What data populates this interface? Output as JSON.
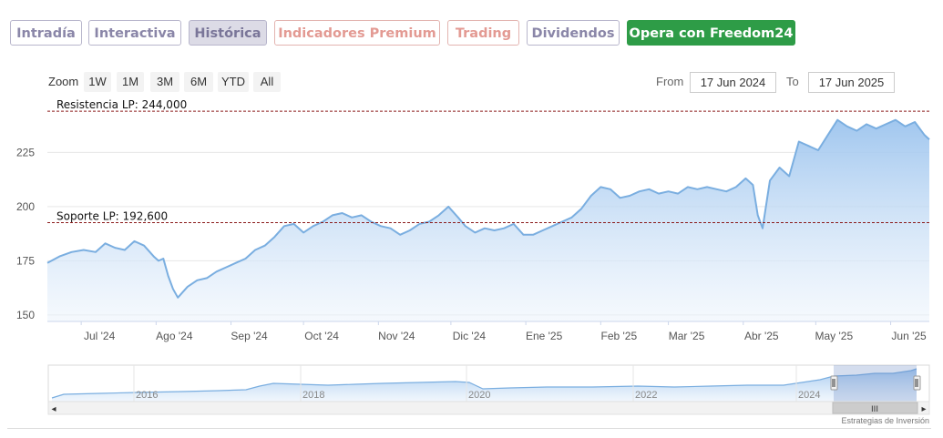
{
  "tabs": [
    {
      "label": "Intradía",
      "style": "default"
    },
    {
      "label": "Interactiva",
      "style": "default"
    },
    {
      "label": "Histórica",
      "style": "active"
    },
    {
      "label": "Indicadores Premium",
      "style": "warm"
    },
    {
      "label": "Trading",
      "style": "warm"
    },
    {
      "label": "Dividendos",
      "style": "default"
    },
    {
      "label": "Opera con Freedom24",
      "style": "cta"
    }
  ],
  "zoom": {
    "label": "Zoom",
    "buttons": [
      "1W",
      "1M",
      "3M",
      "6M",
      "YTD",
      "All"
    ]
  },
  "range": {
    "from_label": "From",
    "from_value": "17 Jun 2024",
    "to_label": "To",
    "to_value": "17 Jun 2025"
  },
  "colors": {
    "series": "#7aaee0",
    "fill_top": "#9cc4ee",
    "fill_bottom": "#edf4fc",
    "dashed_line": "#8b1a1a",
    "grid": "#e6e6e6",
    "cta": "#2e9c47"
  },
  "credit": "Estrategias de Inversión",
  "chart_data": {
    "type": "area",
    "title": "",
    "ylim": [
      147,
      247
    ],
    "y_ticks": [
      150,
      175,
      200,
      225
    ],
    "x_ticks": [
      "Jul '24",
      "Ago '24",
      "Sep '24",
      "Oct '24",
      "Nov '24",
      "Dic '24",
      "Ene '25",
      "Feb '25",
      "Mar '25",
      "Abr '25",
      "May '25",
      "Jun '25"
    ],
    "x_start": "2024-06-17",
    "x_end": "2025-06-17",
    "grid": true,
    "annotations": [
      {
        "label": "Resistencia LP: 244,000",
        "value": 244.0,
        "style": "dashed"
      },
      {
        "label": "Soporte LP: 192,600",
        "value": 192.6,
        "style": "dashed"
      }
    ],
    "series": [
      {
        "x": [
          "2024-06-17",
          "2024-06-22",
          "2024-06-27",
          "2024-07-02",
          "2024-07-07",
          "2024-07-11",
          "2024-07-15",
          "2024-07-19",
          "2024-07-23",
          "2024-07-27",
          "2024-07-31",
          "2024-08-02",
          "2024-08-04",
          "2024-08-06",
          "2024-08-08",
          "2024-08-10",
          "2024-08-14",
          "2024-08-18",
          "2024-08-22",
          "2024-08-26",
          "2024-08-30",
          "2024-09-03",
          "2024-09-07",
          "2024-09-11",
          "2024-09-15",
          "2024-09-19",
          "2024-09-23",
          "2024-09-27",
          "2024-10-01",
          "2024-10-05",
          "2024-10-09",
          "2024-10-13",
          "2024-10-17",
          "2024-10-21",
          "2024-10-25",
          "2024-10-29",
          "2024-11-02",
          "2024-11-06",
          "2024-11-10",
          "2024-11-14",
          "2024-11-18",
          "2024-11-22",
          "2024-11-26",
          "2024-11-30",
          "2024-12-04",
          "2024-12-07",
          "2024-12-11",
          "2024-12-15",
          "2024-12-19",
          "2024-12-23",
          "2024-12-27",
          "2024-12-31",
          "2025-01-04",
          "2025-01-08",
          "2025-01-12",
          "2025-01-16",
          "2025-01-20",
          "2025-01-24",
          "2025-01-28",
          "2025-02-01",
          "2025-02-05",
          "2025-02-09",
          "2025-02-13",
          "2025-02-17",
          "2025-02-21",
          "2025-02-25",
          "2025-03-01",
          "2025-03-05",
          "2025-03-09",
          "2025-03-13",
          "2025-03-17",
          "2025-03-21",
          "2025-03-25",
          "2025-03-29",
          "2025-04-02",
          "2025-04-05",
          "2025-04-07",
          "2025-04-09",
          "2025-04-12",
          "2025-04-16",
          "2025-04-20",
          "2025-04-24",
          "2025-04-28",
          "2025-05-02",
          "2025-05-06",
          "2025-05-10",
          "2025-05-14",
          "2025-05-18",
          "2025-05-22",
          "2025-05-26",
          "2025-05-30",
          "2025-06-03",
          "2025-06-07",
          "2025-06-11",
          "2025-06-15",
          "2025-06-17"
        ],
        "y": [
          174,
          177,
          179,
          180,
          179,
          183,
          181,
          180,
          184,
          182,
          177,
          175,
          176,
          168,
          162,
          158,
          163,
          166,
          167,
          170,
          172,
          174,
          176,
          180,
          182,
          186,
          191,
          192,
          188,
          191,
          193,
          196,
          197,
          195,
          196,
          193,
          191,
          190,
          187,
          189,
          192,
          193,
          196,
          200,
          195,
          191,
          188,
          190,
          189,
          190,
          192,
          187,
          187,
          189,
          191,
          193,
          195,
          199,
          205,
          209,
          208,
          204,
          205,
          207,
          208,
          206,
          207,
          206,
          209,
          208,
          209,
          208,
          207,
          209,
          213,
          210,
          196,
          190,
          212,
          218,
          214,
          230,
          228,
          226,
          233,
          240,
          237,
          235,
          238,
          236,
          238,
          240,
          237,
          239,
          233,
          231
        ]
      }
    ]
  },
  "navigator": {
    "labels": [
      "2016",
      "2018",
      "2020",
      "2022",
      "2024"
    ],
    "scroll_grip": "III",
    "left_arrow": "◂",
    "right_arrow": "▸"
  }
}
